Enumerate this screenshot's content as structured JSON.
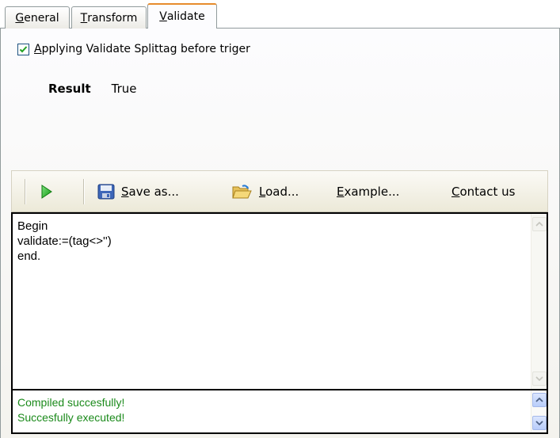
{
  "tabs": [
    {
      "label": "General",
      "underline": "G",
      "rest": "eneral",
      "active": false
    },
    {
      "label": "Transform",
      "underline": "T",
      "rest": "ransform",
      "active": false
    },
    {
      "label": "Validate",
      "underline": "V",
      "rest": "alidate",
      "active": true
    }
  ],
  "options": {
    "checkbox_label_underline": "A",
    "checkbox_label_rest": "pplying Validate Splittag before triger",
    "checked": true
  },
  "result": {
    "label": "Result",
    "value": "True"
  },
  "toolbar": {
    "run_icon": "play-icon",
    "save_underline": "S",
    "save_rest": "ave as...",
    "save_icon": "floppy-disk-icon",
    "load_underline": "L",
    "load_rest": "oad...",
    "load_icon": "folder-open-icon",
    "example_underline": "E",
    "example_rest": "xample...",
    "contact_underline": "C",
    "contact_rest": "ontact us"
  },
  "editor": {
    "code": "Begin\nvalidate:=(tag<>'')\nend."
  },
  "output": {
    "lines": [
      "Compiled succesfully!",
      "Succesfully executed!"
    ],
    "color": "#1b8a1b"
  },
  "colors": {
    "active_tab_accent": "#e68b2c",
    "play_green": "#2fb52f"
  }
}
